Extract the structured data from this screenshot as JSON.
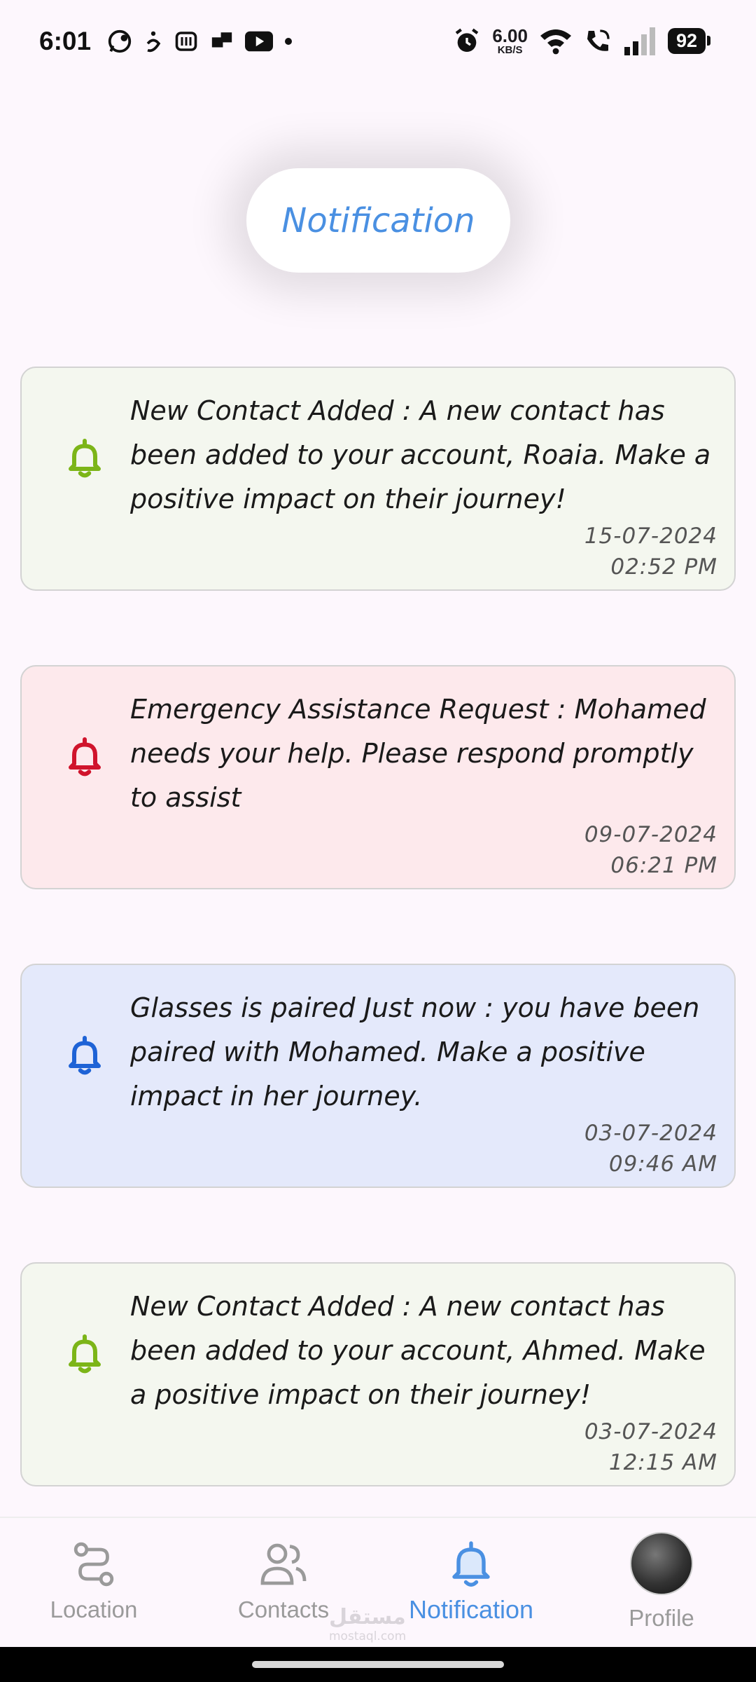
{
  "status_bar": {
    "time": "6:01",
    "network_speed": "6.00",
    "network_unit": "KB/S",
    "battery": "92"
  },
  "header": {
    "title": "Notification"
  },
  "notifications": [
    {
      "message": "New Contact Added : A new contact has been added to your account, Roaia. Make a positive impact on their journey!",
      "date": "15-07-2024",
      "time": "02:52 PM",
      "bell_color": "#7cb518",
      "card_color": "#f4f7ef"
    },
    {
      "message": "Emergency Assistance Request : Mohamed needs your help. Please respond promptly to assist",
      "date": "09-07-2024",
      "time": "06:21 PM",
      "bell_color": "#d0142c",
      "card_color": "#fde9ec"
    },
    {
      "message": "Glasses is paired Just now : you have been paired with Mohamed. Make a positive impact in her journey.",
      "date": "03-07-2024",
      "time": "09:46 AM",
      "bell_color": "#1e63d6",
      "card_color": "#e4e9fb"
    },
    {
      "message": "New Contact Added : A new contact has been added to your account, Ahmed. Make a positive impact on their journey!",
      "date": "03-07-2024",
      "time": "12:15 AM",
      "bell_color": "#7cb518",
      "card_color": "#f4f7ef"
    }
  ],
  "bottom_nav": {
    "items": [
      {
        "label": "Location",
        "icon": "route-icon",
        "active": false
      },
      {
        "label": "Contacts",
        "icon": "contacts-icon",
        "active": false
      },
      {
        "label": "Notification",
        "icon": "bell-icon",
        "active": true
      },
      {
        "label": "Profile",
        "icon": "avatar",
        "active": false
      }
    ],
    "active_color": "#4a90e2",
    "inactive_color": "#9a9a9a"
  },
  "watermark": {
    "text": "مستقل",
    "sub": "mostaql.com"
  }
}
